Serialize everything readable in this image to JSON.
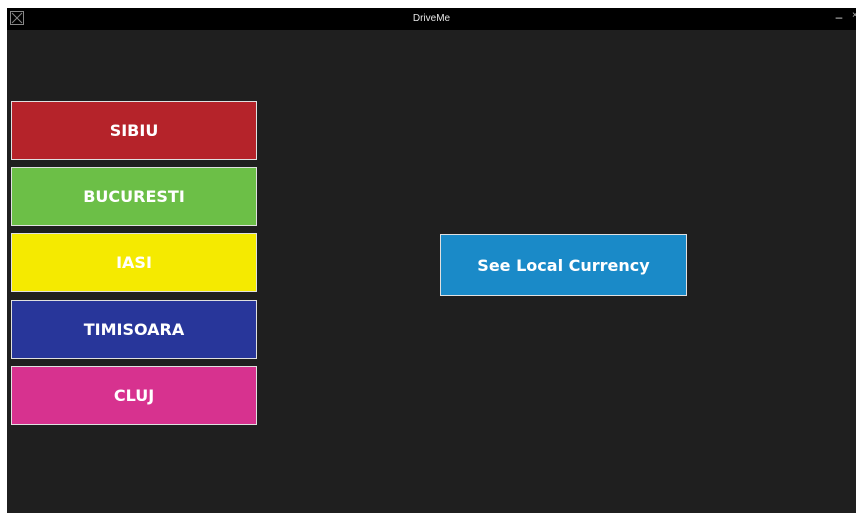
{
  "window": {
    "title": "DriveMe",
    "minimize_label": "–",
    "close_label": "×"
  },
  "cities": [
    {
      "label": "SIBIU",
      "color": "#b5232a"
    },
    {
      "label": "BUCURESTI",
      "color": "#6cbf47"
    },
    {
      "label": "IASI",
      "color": "#f5ea00"
    },
    {
      "label": "TIMISOARA",
      "color": "#28369a"
    },
    {
      "label": "CLUJ",
      "color": "#d7328f"
    }
  ],
  "currency_button": {
    "label": "See Local Currency",
    "color": "#1a8ac8"
  },
  "colors": {
    "background": "#1f1f1f",
    "titlebar": "#000000"
  }
}
